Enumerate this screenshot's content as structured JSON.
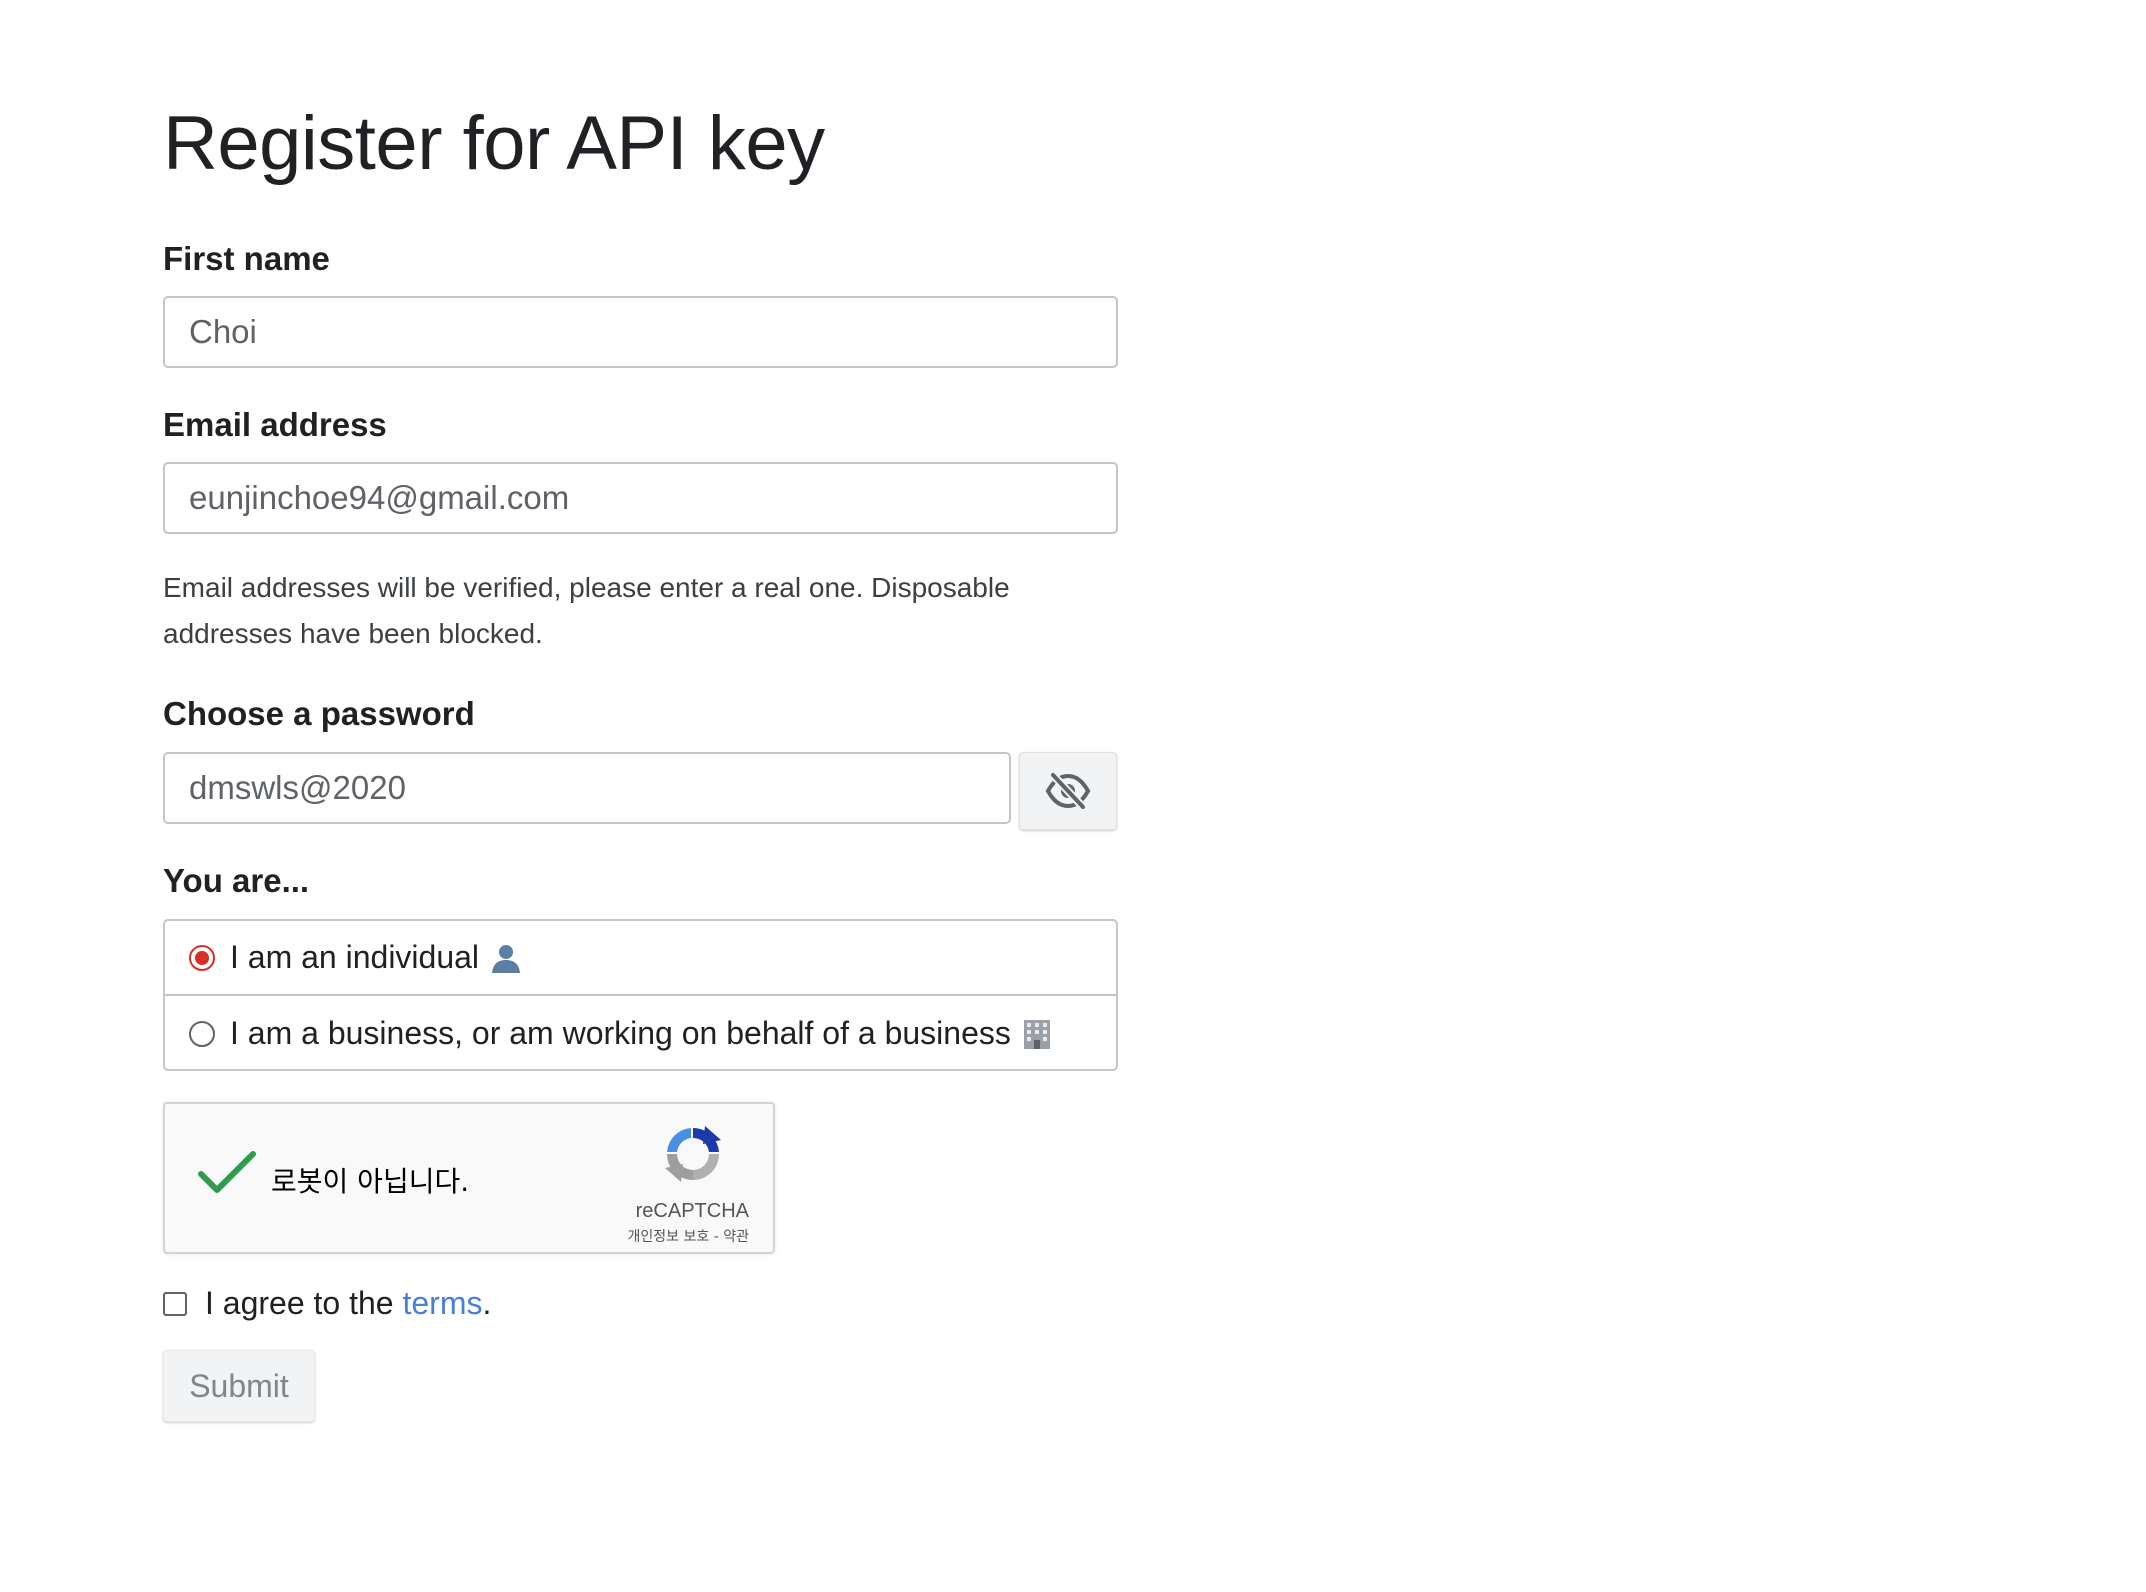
{
  "page": {
    "title": "Register for API key"
  },
  "form": {
    "first_name": {
      "label": "First name",
      "value": "Choi"
    },
    "email": {
      "label": "Email address",
      "value": "eunjinchoe94@gmail.com",
      "help_text": "Email addresses will be verified, please enter a real one. Disposable addresses have been blocked."
    },
    "password": {
      "label": "Choose a password",
      "value": "dmswls@2020",
      "toggle_icon": "eye-off-icon"
    },
    "you_are": {
      "label": "You are...",
      "options": [
        {
          "label": "I am an individual",
          "emoji_icon": "person-silhouette-icon",
          "selected": true
        },
        {
          "label": "I am a business, or am working on behalf of a business",
          "emoji_icon": "office-building-icon",
          "selected": false
        }
      ]
    },
    "captcha": {
      "text": "로봇이 아닙니다.",
      "brand": "reCAPTCHA",
      "links": "개인정보 보호 - 약관",
      "checked": true
    },
    "agree": {
      "prefix": "I agree to the ",
      "link_text": "terms",
      "suffix": ".",
      "checked": false
    },
    "submit_label": "Submit"
  },
  "colors": {
    "radio_selected": "#d93025",
    "link": "#4a7fd8",
    "captcha_check": "#2e9b4f"
  }
}
